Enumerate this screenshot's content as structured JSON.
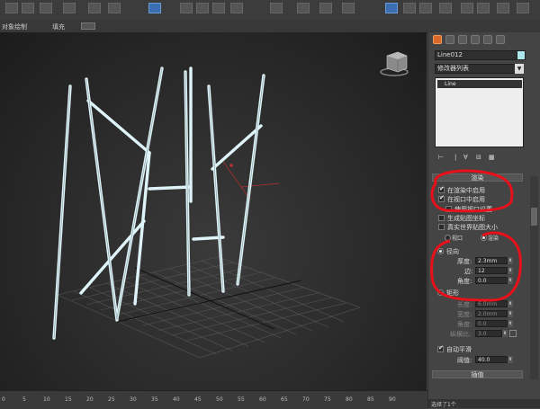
{
  "toolbar": {
    "label_object_paint": "对象绘制",
    "label_fill": "填充"
  },
  "panel": {
    "object_name": "Line012",
    "modifier_list_label": "修改器列表",
    "stack_items": [
      "Line"
    ],
    "rendering": {
      "header": "渲染",
      "enable_in_renderer": "在渲染中启用",
      "enable_in_viewport": "在视口中启用",
      "use_viewport_settings": "使用视口设置",
      "generate_mapping": "生成贴图坐标",
      "real_world_map_size": "真实世界贴图大小",
      "viewport_label": "视口",
      "render_label": "渲染",
      "radial_label": "径向",
      "thickness_label": "厚度:",
      "thickness_value": "2.3mm",
      "sides_label": "边:",
      "sides_value": "12",
      "angle_label": "角度:",
      "angle_value": "0.0",
      "rectangular_label": "矩形",
      "length_label": "长度:",
      "length_value": "6.0mm",
      "width_label": "宽度:",
      "width_value": "2.0mm",
      "rect_angle_label": "角度:",
      "rect_angle_value": "0.0",
      "aspect_label": "纵横比:",
      "aspect_value": "3.0",
      "auto_smooth": "自动平滑",
      "threshold_label": "阈值:",
      "threshold_value": "40.0"
    },
    "interpolation_header": "插值"
  },
  "timeline": {
    "ticks": [
      "0",
      "5",
      "10",
      "15",
      "20",
      "25",
      "30",
      "35",
      "40",
      "45",
      "50",
      "55",
      "60",
      "65",
      "70",
      "75",
      "80",
      "85",
      "90"
    ],
    "selection": "选择了1个"
  },
  "colors": {
    "annotation_red": "#e8101a",
    "viewport_bg": "#2a2a2a",
    "object_color": "#dff4f8",
    "active_tab": "#d9682a"
  },
  "icons": [
    "create-icon",
    "modify-icon",
    "hierarchy-icon",
    "motion-icon",
    "display-icon",
    "utilities-icon",
    "viewcube-icon"
  ]
}
